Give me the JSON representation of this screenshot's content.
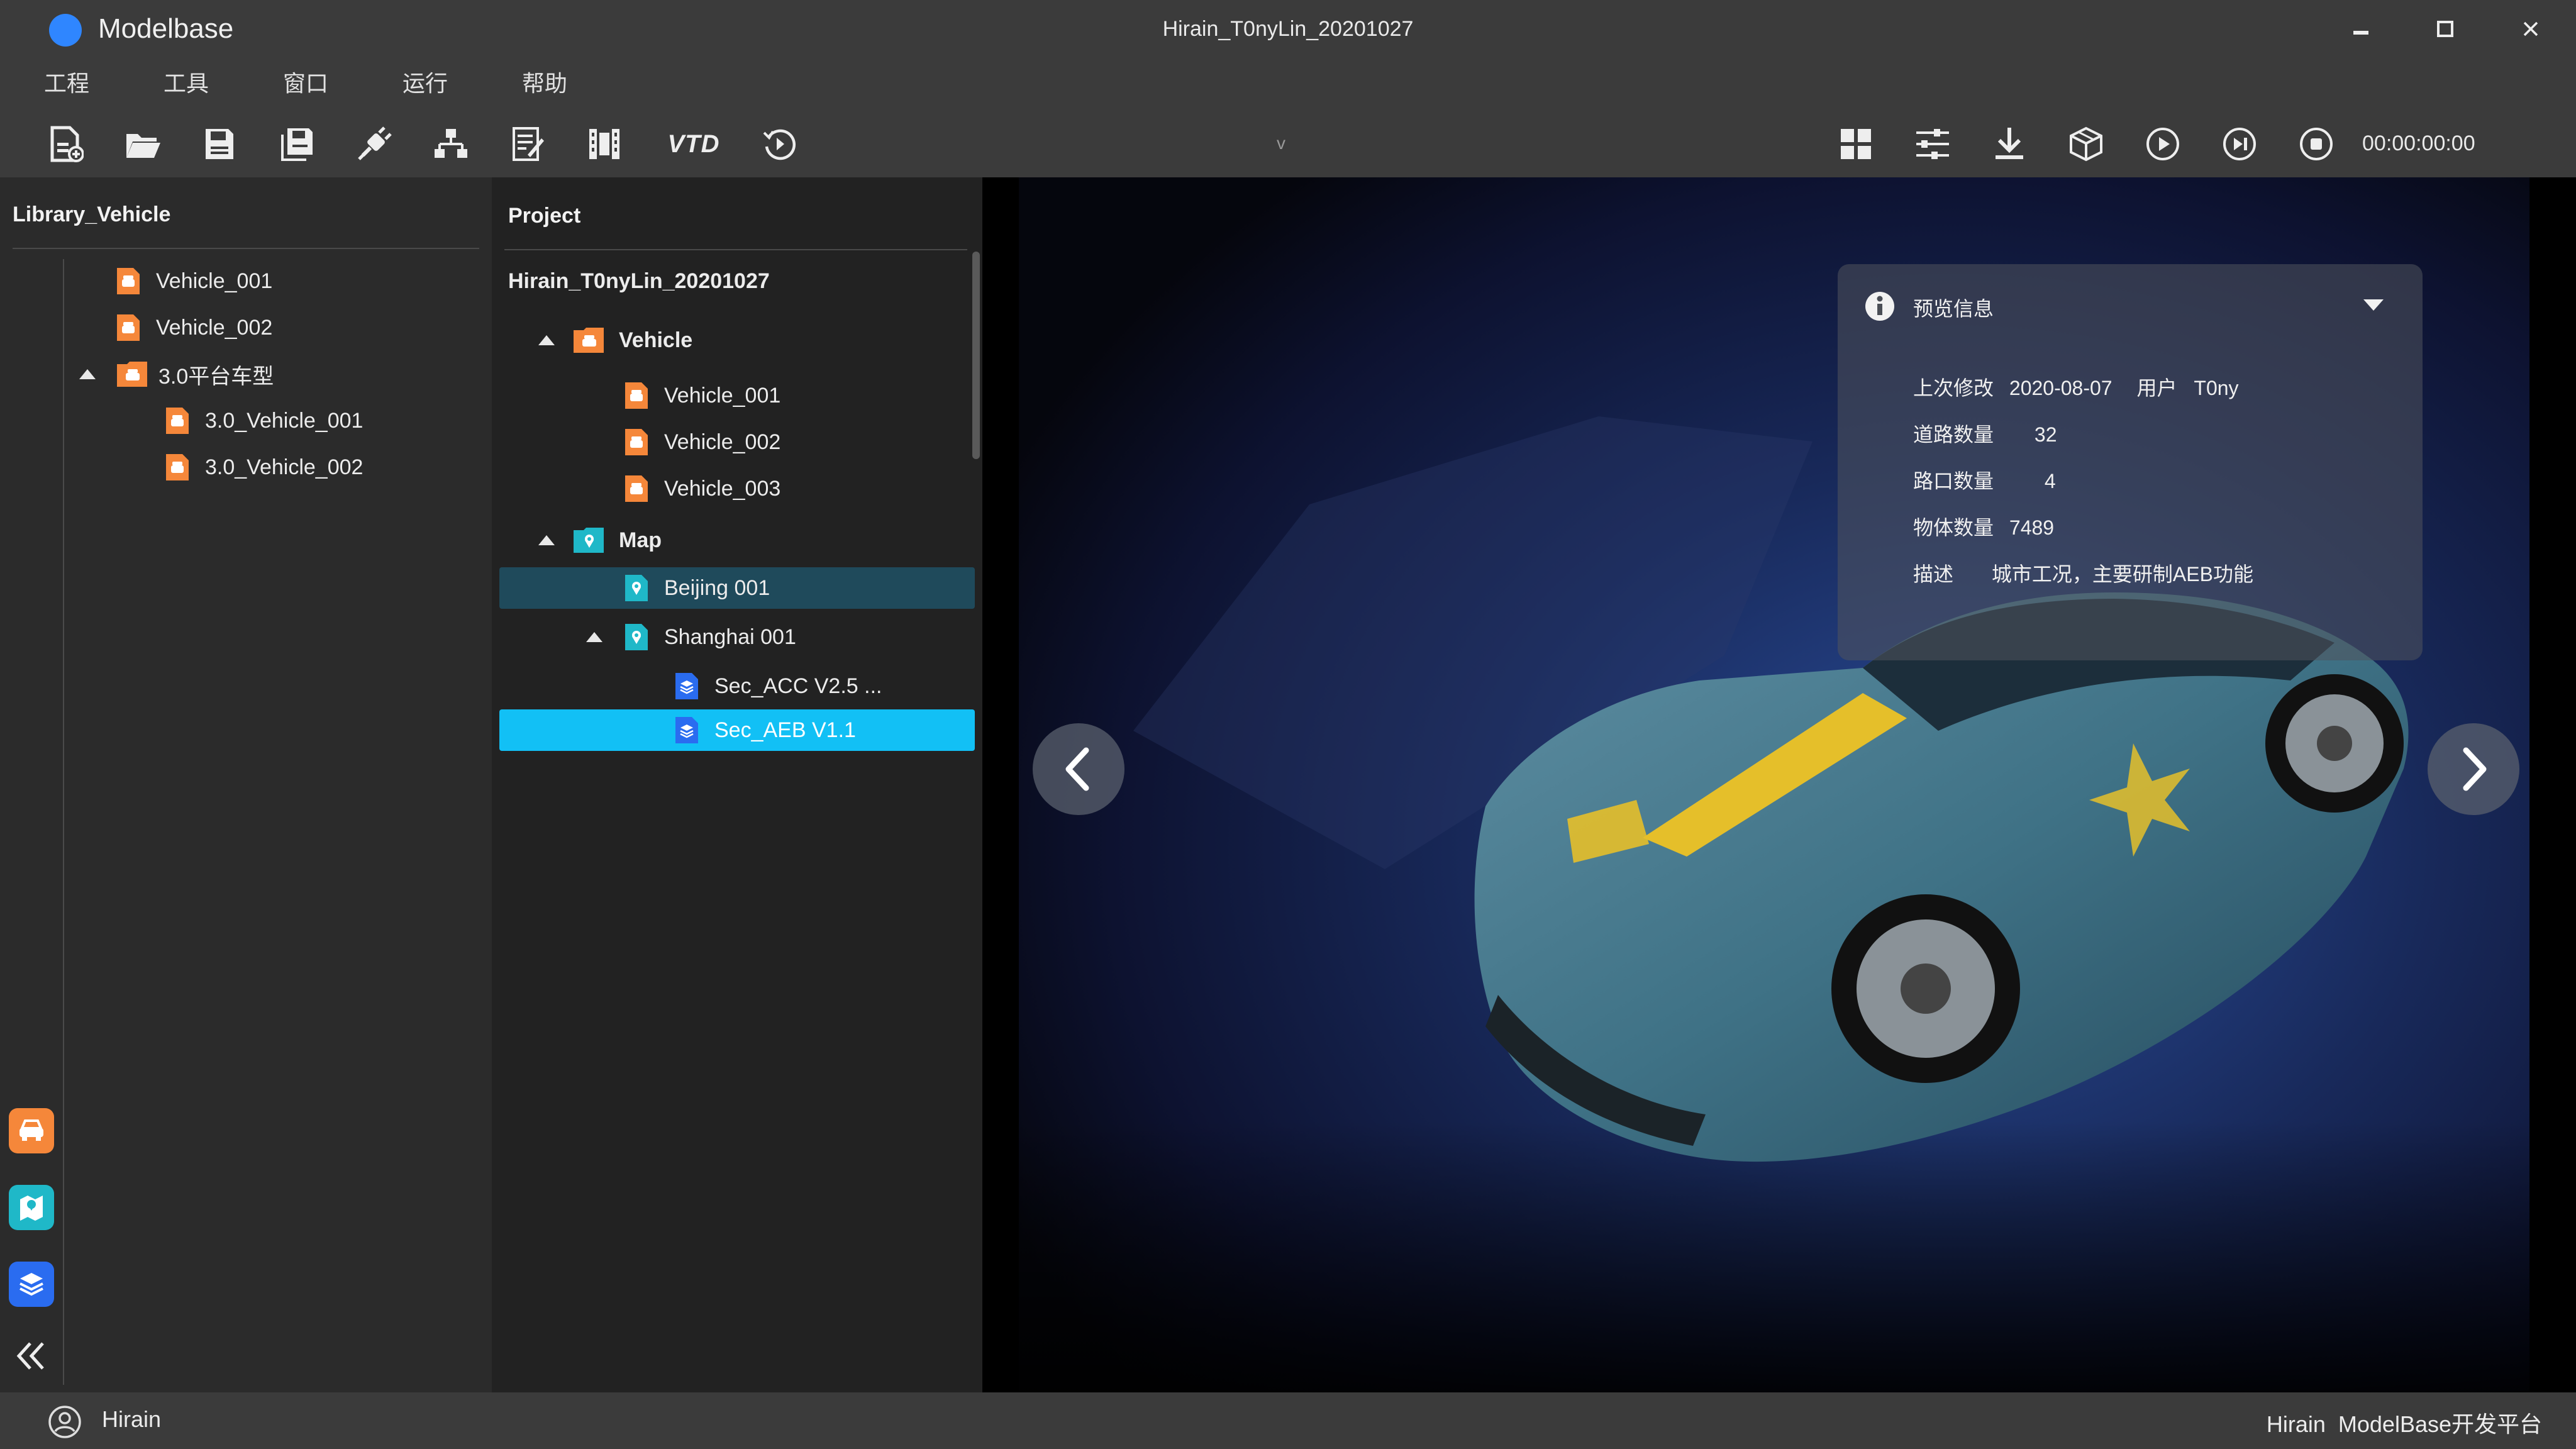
{
  "app": {
    "name": "Modelbase",
    "window_title": "Hirain_T0nyLin_20201027"
  },
  "menu": [
    "工程",
    "工具",
    "窗口",
    "运行",
    "帮助"
  ],
  "toolbar": {
    "tools_left": [
      "new-project-icon",
      "open-folder-icon",
      "save-icon",
      "save-all-icon",
      "plugin-icon",
      "hierarchy-icon",
      "edit-list-icon",
      "film-icon",
      "vtd-logo-icon",
      "history-icon"
    ],
    "vtd_text": "VTD",
    "v_marker": "v",
    "tools_right": [
      "grid-icon",
      "sliders-icon",
      "download-icon",
      "cube-icon",
      "play-icon",
      "step-icon",
      "stop-icon"
    ],
    "timer": "00:00:00:00"
  },
  "library": {
    "title": "Library_Vehicle",
    "items": [
      {
        "label": "Vehicle_001",
        "icon": "vehicle-file-icon"
      },
      {
        "label": "Vehicle_002",
        "icon": "vehicle-file-icon"
      },
      {
        "label": "3.0平台车型",
        "icon": "vehicle-folder-icon",
        "expanded": true
      },
      {
        "label": "3.0_Vehicle_001",
        "icon": "vehicle-file-icon"
      },
      {
        "label": "3.0_Vehicle_002",
        "icon": "vehicle-file-icon"
      }
    ]
  },
  "side_apps": [
    "vehicle-app-icon",
    "map-app-icon",
    "layers-app-icon",
    "collapse-icon"
  ],
  "project": {
    "title": "Project",
    "root": "Hirain_T0nyLin_20201027",
    "vehicle_group": "Vehicle",
    "vehicles": [
      "Vehicle_001",
      "Vehicle_002",
      "Vehicle_003"
    ],
    "map_group": "Map",
    "maps": [
      "Beijing 001",
      "Shanghai 001"
    ],
    "scenarios": [
      "Sec_ACC V2.5 ...",
      "Sec_AEB V1.1"
    ],
    "selected": "Sec_AEB V1.1"
  },
  "preview_info": {
    "title": "预览信息",
    "modified_label": "上次修改",
    "modified_value": "2020-08-07",
    "user_label": "用户",
    "user_value": "T0ny",
    "roads_label": "道路数量",
    "roads_value": "32",
    "junctions_label": "路口数量",
    "junctions_value": "4",
    "objects_label": "物体数量",
    "objects_value": "7489",
    "desc_label": "描述",
    "desc_value": "城市工况，主要研制AEB功能"
  },
  "status": {
    "user": "Hirain",
    "brand": "Hirain  ModelBase开发平台"
  },
  "colors": {
    "accent": "#12c0f5",
    "vehicle_orange": "#f5873a",
    "map_teal": "#1fb8c8",
    "scenario_blue": "#2a6cf0"
  }
}
